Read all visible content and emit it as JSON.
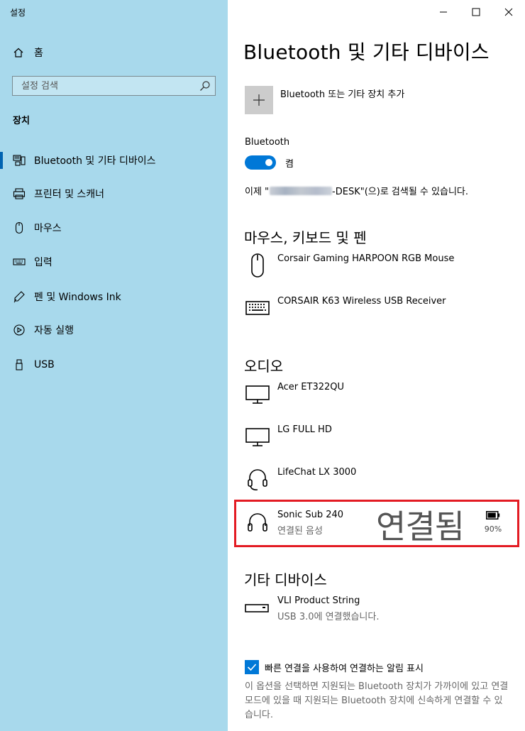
{
  "window": {
    "title": "설정",
    "controls": {
      "minimize": "─",
      "maximize": "☐",
      "close": "✕"
    }
  },
  "sidebar": {
    "home_label": "홈",
    "search_placeholder": "설정 검색",
    "section_label": "장치",
    "items": [
      {
        "label": "Bluetooth 및 기타 디바이스",
        "icon": "bluetooth-devices-icon",
        "selected": true
      },
      {
        "label": "프린터 및 스캐너",
        "icon": "printer-icon",
        "selected": false
      },
      {
        "label": "마우스",
        "icon": "mouse-icon",
        "selected": false
      },
      {
        "label": "입력",
        "icon": "keyboard-icon",
        "selected": false
      },
      {
        "label": "펜 및 Windows Ink",
        "icon": "pen-icon",
        "selected": false
      },
      {
        "label": "자동 실행",
        "icon": "autoplay-icon",
        "selected": false
      },
      {
        "label": "USB",
        "icon": "usb-icon",
        "selected": false
      }
    ]
  },
  "main": {
    "title": "Bluetooth 및 기타 디바이스",
    "add_device_label": "Bluetooth 또는 기타 장치 추가",
    "bluetooth_label": "Bluetooth",
    "bluetooth_state": "켬",
    "discoverable_prefix": "이제 \"",
    "discoverable_suffix": "-DESK\"(으)로 검색될 수 있습니다.",
    "sections": {
      "mouse_keyboard_pen": {
        "heading": "마우스, 키보드 및 펜",
        "devices": [
          {
            "name": "Corsair Gaming HARPOON RGB Mouse",
            "status": "",
            "icon": "mouse-icon"
          },
          {
            "name": "CORSAIR K63 Wireless USB Receiver",
            "status": "",
            "icon": "keyboard-icon"
          }
        ]
      },
      "audio": {
        "heading": "오디오",
        "devices": [
          {
            "name": "Acer ET322QU",
            "status": "",
            "icon": "monitor-icon"
          },
          {
            "name": "LG FULL HD",
            "status": "",
            "icon": "monitor-icon"
          },
          {
            "name": "LifeChat LX 3000",
            "status": "",
            "icon": "headset-icon"
          },
          {
            "name": "Sonic Sub 240",
            "status": "연결된 음성",
            "icon": "headphones-icon",
            "battery": "90%",
            "battery_level": 0.9
          }
        ]
      },
      "other": {
        "heading": "기타 디바이스",
        "devices": [
          {
            "name": "VLI Product String",
            "status": "USB 3.0에 연결했습니다.",
            "icon": "usb-device-icon"
          }
        ]
      }
    },
    "annotation": {
      "text": "연결됨",
      "highlight_color": "#e31b23"
    },
    "swift_pair": {
      "checked": true,
      "label": "빠른 연결을 사용하여 연결하는 알림 표시",
      "description": "이 옵션을 선택하면 지원되는 Bluetooth 장치가 가까이에 있고 연결 모드에 있을 때 지원되는 Bluetooth 장치에 신속하게 연결할 수 있습니다."
    }
  },
  "colors": {
    "sidebar_bg": "#a8d9ec",
    "accent": "#0078d7",
    "selection_bar": "#0063b1"
  }
}
